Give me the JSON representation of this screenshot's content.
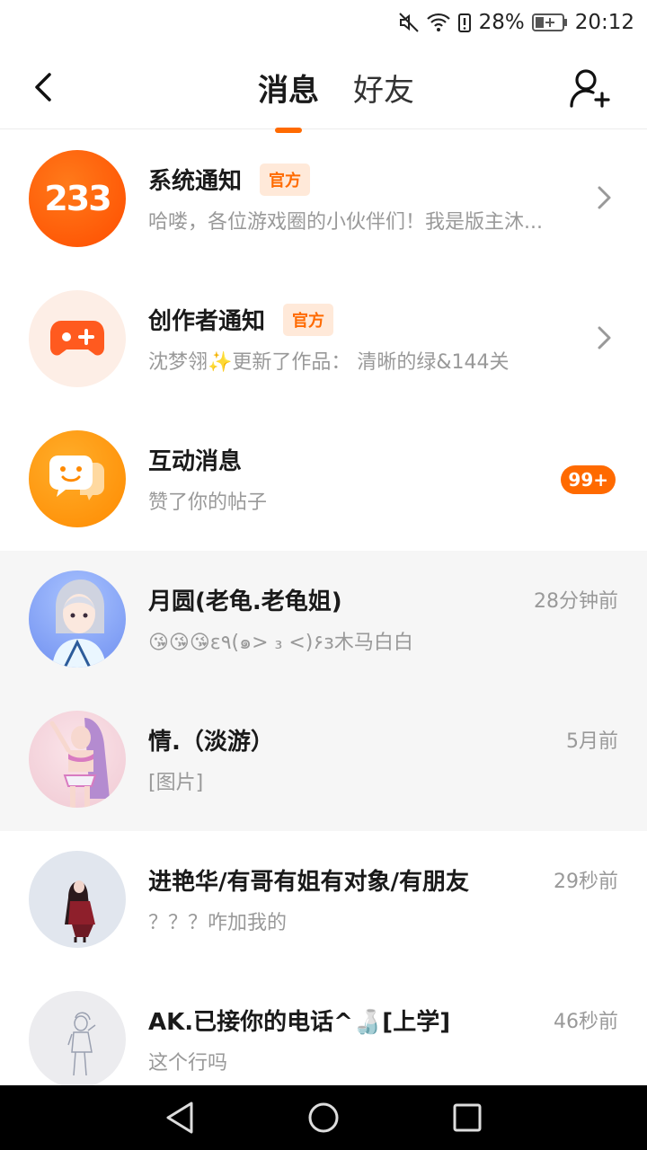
{
  "status": {
    "battery_pct": "28%",
    "time": "20:12"
  },
  "header": {
    "tabs": [
      {
        "label": "消息",
        "active": true
      },
      {
        "label": "好友",
        "active": false
      }
    ]
  },
  "colors": {
    "accent": "#ff6a00",
    "badge_bg": "#ffe9d9"
  },
  "conversations": [
    {
      "title": "系统通知",
      "badge": "官方",
      "subtitle": "哈喽，各位游戏圈的小伙伴们！我是版主沐...",
      "avatar_text": "233",
      "icon": "233-logo-icon"
    },
    {
      "title": "创作者通知",
      "badge": "官方",
      "subtitle": "沈梦翎✨更新了作品：  清晰的绿&144关",
      "icon": "gamepad-icon"
    },
    {
      "title": "互动消息",
      "subtitle": "赞了你的帖子",
      "count": "99+",
      "icon": "chat-bubble-icon"
    },
    {
      "title": "月圆(老龟.老龟姐)",
      "subtitle": "😘😘😘ε٩(๑> ₃ <)۶з木马白白",
      "time": "28分钟前"
    },
    {
      "title": "情.（淡游）",
      "subtitle": "[图片]",
      "time": "5月前"
    },
    {
      "title": "进艳华/有哥有姐有对象/有朋友",
      "subtitle": "？？？咋加我的",
      "time": "29秒前"
    },
    {
      "title": "AK.已接你的电话^🍶[上学]",
      "subtitle": "这个行吗",
      "time": "46秒前"
    }
  ]
}
